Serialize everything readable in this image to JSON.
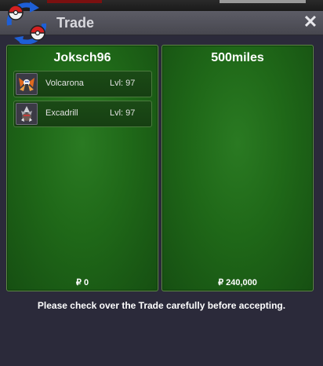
{
  "window": {
    "title": "Trade",
    "close_label": "✕"
  },
  "left_panel": {
    "trainer": "Joksch96",
    "pokemon": [
      {
        "name": "Volcarona",
        "level": "Lvl: 97",
        "icon": "volcarona-sprite-icon"
      },
      {
        "name": "Excadrill",
        "level": "Lvl: 97",
        "icon": "excadrill-sprite-icon"
      }
    ],
    "money": "₽ 0"
  },
  "right_panel": {
    "trainer": "500miles",
    "money": "₽ 240,000"
  },
  "notice": "Please check over the Trade carefully before accepting.",
  "colors": {
    "panel_green": "#1f6818",
    "panel_border": "#5d8b44",
    "window_bg": "#2b2a3a",
    "title_bar": "#55555e"
  }
}
